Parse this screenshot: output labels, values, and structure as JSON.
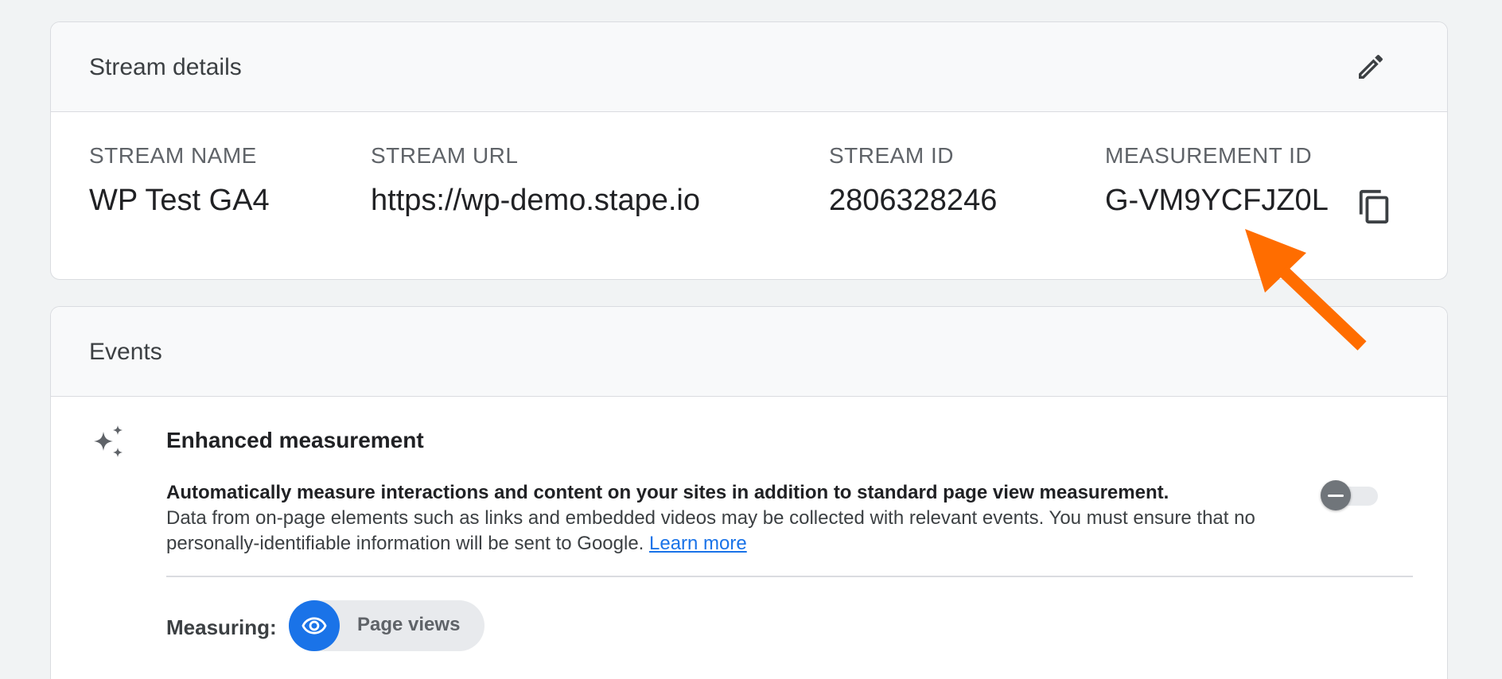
{
  "stream_details": {
    "title": "Stream details",
    "edit_icon": "pencil-icon",
    "fields": {
      "stream_name": {
        "label": "STREAM NAME",
        "value": "WP Test GA4"
      },
      "stream_url": {
        "label": "STREAM URL",
        "value": "https://wp-demo.stape.io"
      },
      "stream_id": {
        "label": "STREAM ID",
        "value": "2806328246"
      },
      "measurement_id": {
        "label": "MEASUREMENT ID",
        "value": "G-VM9YCFJZ0L"
      }
    },
    "copy_icon": "copy-icon"
  },
  "events": {
    "title": "Events",
    "enhanced_measurement": {
      "icon": "sparkle-icon",
      "title": "Enhanced measurement",
      "description_bold": "Automatically measure interactions and content on your sites in addition to standard page view measurement.",
      "description": "Data from on-page elements such as links and embedded videos may be collected with relevant events. You must ensure that no personally-identifiable information will be sent to Google.",
      "learn_more": "Learn more",
      "toggle_on": false
    },
    "measuring_label": "Measuring:",
    "chips": [
      {
        "icon": "eye-icon",
        "label": "Page views"
      }
    ]
  },
  "colors": {
    "accent": "#1a73e8",
    "annotation_arrow": "#ff6d00",
    "background": "#f1f3f4"
  }
}
